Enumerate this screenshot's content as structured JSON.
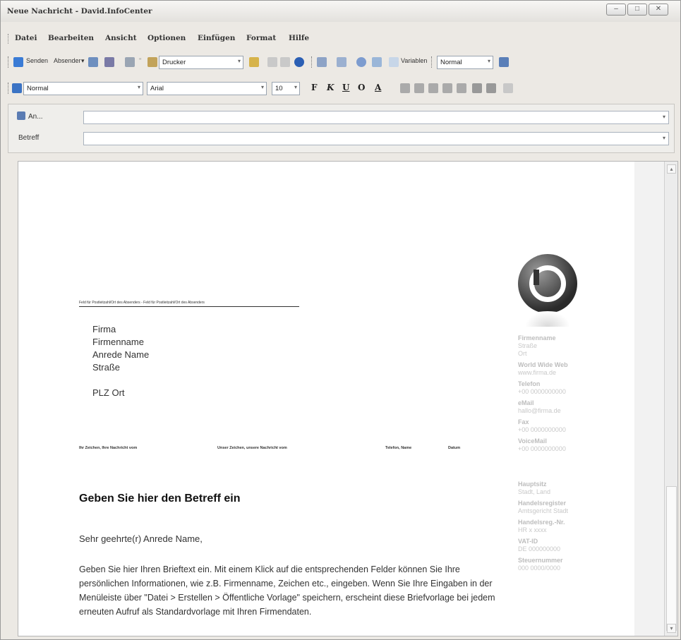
{
  "window": {
    "title": "Neue Nachricht - David.InfoCenter"
  },
  "menu": [
    "Datei",
    "Bearbeiten",
    "Ansicht",
    "Optionen",
    "Einfügen",
    "Format",
    "Hilfe"
  ],
  "toolbar1": {
    "send": "Senden",
    "sender": "Absender",
    "printer": "Drucker",
    "variables": "Variablen",
    "style_combo": "Normal"
  },
  "toolbar2": {
    "paragraph_style": "Normal",
    "font": "Arial",
    "size": "10",
    "bold": "F",
    "italic": "K",
    "underline": "U",
    "strike": "O",
    "fontcolor": "A"
  },
  "header": {
    "to_label": "An...",
    "subject_label": "Betreff",
    "to_value": "",
    "subject_value": ""
  },
  "letter": {
    "sender_line": "Feld für Postleitzahl/Ort des Absenders - Feld für Postleitzahl/Ort des Absenders",
    "address": [
      "Firma",
      "Firmenname",
      "Anrede Name",
      "Straße",
      "",
      "PLZ Ort"
    ],
    "refs": {
      "ref1": "Ihr Zeichen, Ihre Nachricht vom",
      "ref2": "Unser Zeichen, unsere Nachricht vom",
      "ref3": "Telefon, Name",
      "ref4": "Datum"
    },
    "subject": "Geben Sie hier den Betreff ein",
    "salutation": "Sehr geehrte(r) Anrede Name,",
    "body": "Geben Sie hier Ihren Brieftext ein. Mit einem Klick auf die entsprechenden Felder können Sie Ihre persönlichen Informationen, wie z.B. Firmenname, Zeichen etc., eingeben. Wenn Sie Ihre Eingaben in der Menüleiste über \"Datei > Erstellen > Öffentliche Vorlage\" speichern, erscheint diese Briefvorlage bei jedem erneuten Aufruf als Standardvorlage mit Ihren Firmendaten."
  },
  "sidebar": [
    {
      "label": "Firmenname",
      "value": "Straße\nOrt"
    },
    {
      "label": "World Wide Web",
      "value": "www.firma.de"
    },
    {
      "label": "Telefon",
      "value": "+00 0000000000"
    },
    {
      "label": "eMail",
      "value": "hallo@firma.de"
    },
    {
      "label": "Fax",
      "value": "+00 0000000000"
    },
    {
      "label": "VoiceMail",
      "value": "+00 0000000000"
    },
    {
      "label": "Hauptsitz",
      "value": "Stadt, Land"
    },
    {
      "label": "Handelsregister",
      "value": "Amtsgericht Stadt"
    },
    {
      "label": "Handelsreg.-Nr.",
      "value": "HR x xxxx"
    },
    {
      "label": "VAT-ID",
      "value": "DE 000000000"
    },
    {
      "label": "Steuernummer",
      "value": "000 0000/0000"
    }
  ]
}
